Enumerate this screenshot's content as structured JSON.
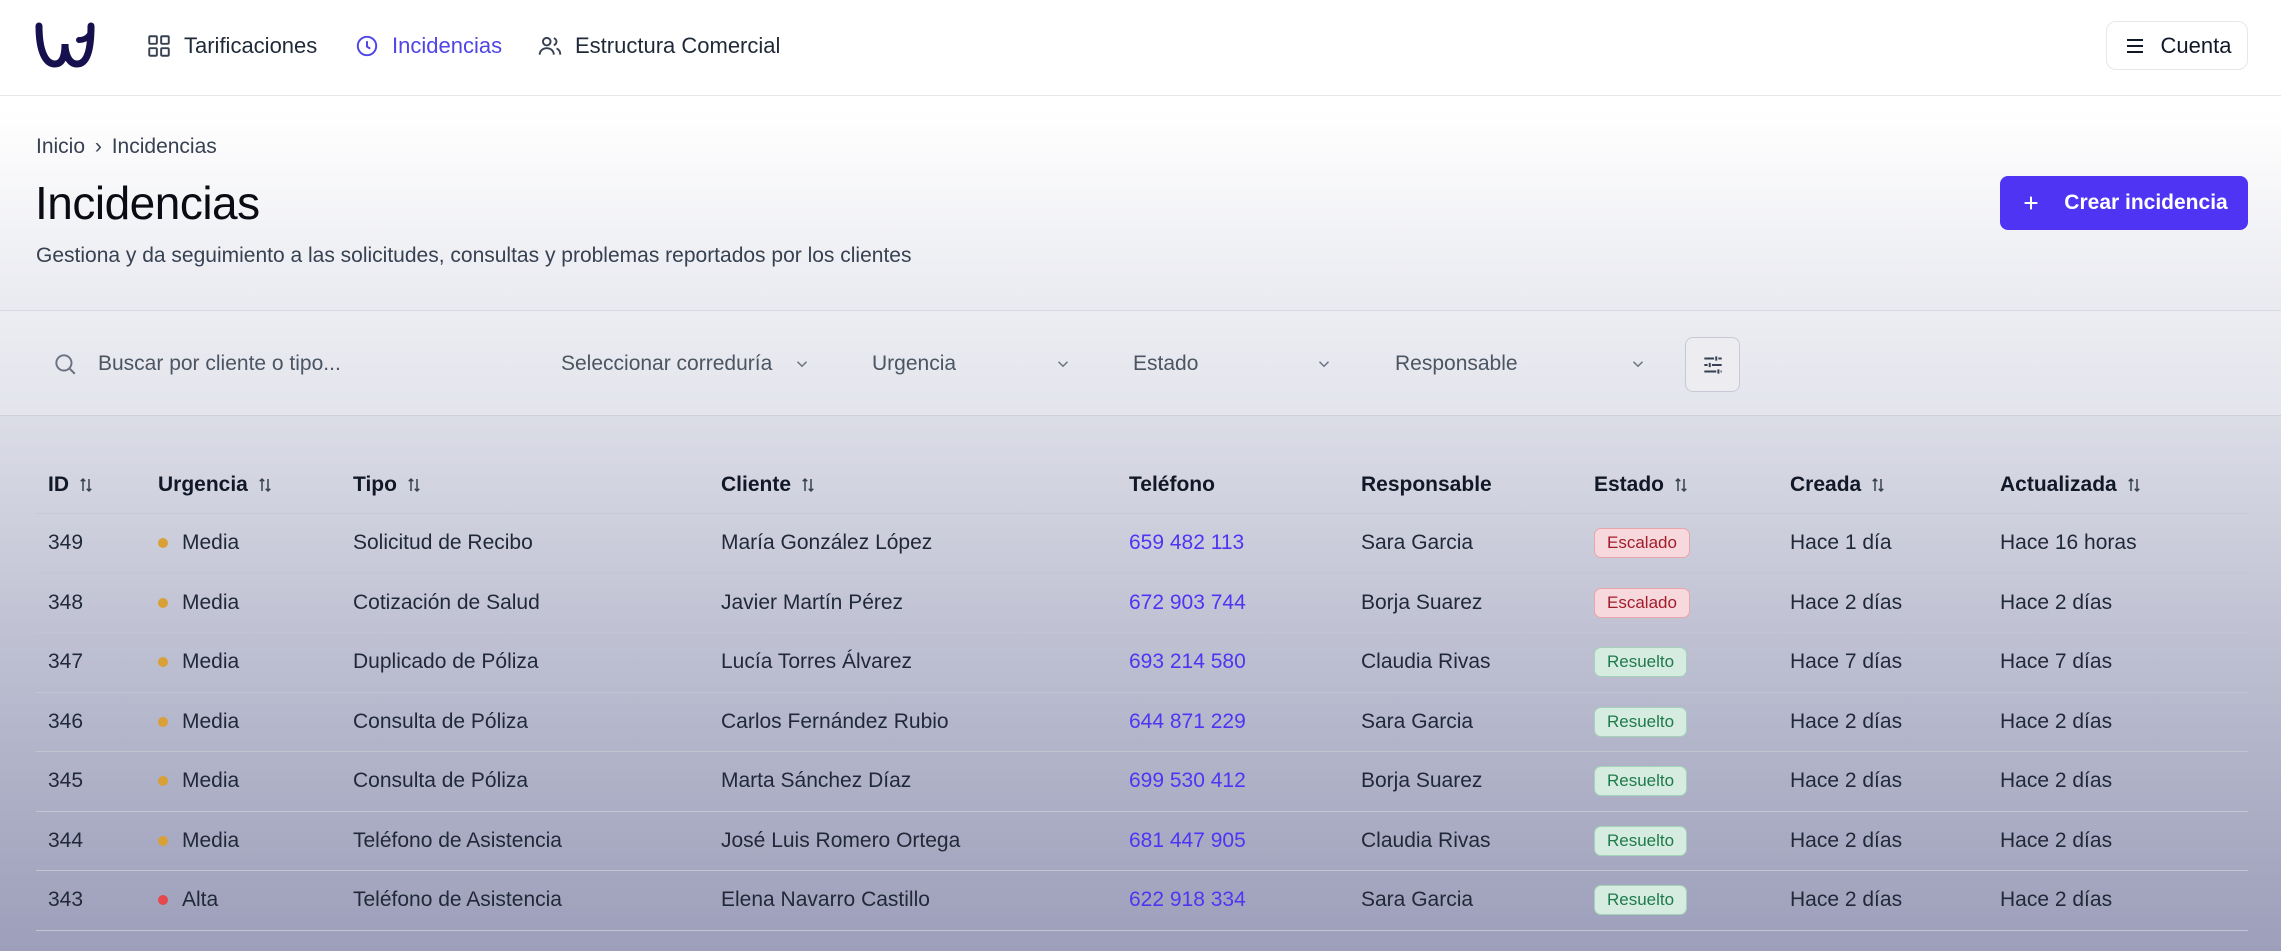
{
  "nav": {
    "items": [
      {
        "label": "Tarificaciones",
        "icon": "grid-icon"
      },
      {
        "label": "Incidencias",
        "icon": "clock-icon",
        "active": true
      },
      {
        "label": "Estructura Comercial",
        "icon": "users-icon"
      }
    ],
    "account_label": "Cuenta"
  },
  "header": {
    "breadcrumb": {
      "home": "Inicio",
      "sep": "›",
      "current": "Incidencias"
    },
    "title": "Incidencias",
    "subtitle": "Gestiona y da seguimiento a las solicitudes, consultas y problemas reportados por los clientes",
    "create_label": "Crear incidencia"
  },
  "filters": {
    "search_placeholder": "Buscar por cliente o tipo...",
    "correduria": "Seleccionar correduría",
    "urgencia": "Urgencia",
    "estado": "Estado",
    "responsable": "Responsable"
  },
  "colors": {
    "accent": "#4f35f3",
    "urgency_media": "#d9a036",
    "urgency_alta": "#e5484d",
    "escalado": "#a11d2b",
    "resuelto": "#1f7a4b"
  },
  "table": {
    "headers": {
      "id": "ID",
      "urgencia": "Urgencia",
      "tipo": "Tipo",
      "cliente": "Cliente",
      "telefono": "Teléfono",
      "responsable": "Responsable",
      "estado": "Estado",
      "creada": "Creada",
      "actualizada": "Actualizada"
    },
    "rows": [
      {
        "id": "349",
        "urgencia": "Media",
        "tipo": "Solicitud de Recibo",
        "cliente": "María González López",
        "telefono": "659 482 113",
        "responsable": "Sara Garcia",
        "estado": "Escalado",
        "creada": "Hace 1 día",
        "actualizada": "Hace 16 horas"
      },
      {
        "id": "348",
        "urgencia": "Media",
        "tipo": "Cotización de Salud",
        "cliente": "Javier Martín Pérez",
        "telefono": "672 903 744",
        "responsable": "Borja Suarez",
        "estado": "Escalado",
        "creada": "Hace 2 días",
        "actualizada": "Hace 2 días"
      },
      {
        "id": "347",
        "urgencia": "Media",
        "tipo": "Duplicado de Póliza",
        "cliente": "Lucía Torres Álvarez",
        "telefono": "693 214 580",
        "responsable": "Claudia Rivas",
        "estado": "Resuelto",
        "creada": "Hace 7 días",
        "actualizada": "Hace 7 días"
      },
      {
        "id": "346",
        "urgencia": "Media",
        "tipo": "Consulta de Póliza",
        "cliente": "Carlos Fernández Rubio",
        "telefono": "644 871 229",
        "responsable": "Sara Garcia",
        "estado": "Resuelto",
        "creada": "Hace 2 días",
        "actualizada": "Hace 2 días"
      },
      {
        "id": "345",
        "urgencia": "Media",
        "tipo": "Consulta de Póliza",
        "cliente": "Marta Sánchez Díaz",
        "telefono": "699 530 412",
        "responsable": "Borja Suarez",
        "estado": "Resuelto",
        "creada": "Hace 2 días",
        "actualizada": "Hace 2 días"
      },
      {
        "id": "344",
        "urgencia": "Media",
        "tipo": "Teléfono de Asistencia",
        "cliente": "José Luis Romero Ortega",
        "telefono": "681 447 905",
        "responsable": "Claudia Rivas",
        "estado": "Resuelto",
        "creada": "Hace 2 días",
        "actualizada": "Hace 2 días"
      },
      {
        "id": "343",
        "urgencia": "Alta",
        "tipo": "Teléfono de Asistencia",
        "cliente": "Elena Navarro Castillo",
        "telefono": "622 918 334",
        "responsable": "Sara Garcia",
        "estado": "Resuelto",
        "creada": "Hace 2 días",
        "actualizada": "Hace 2 días"
      }
    ]
  }
}
